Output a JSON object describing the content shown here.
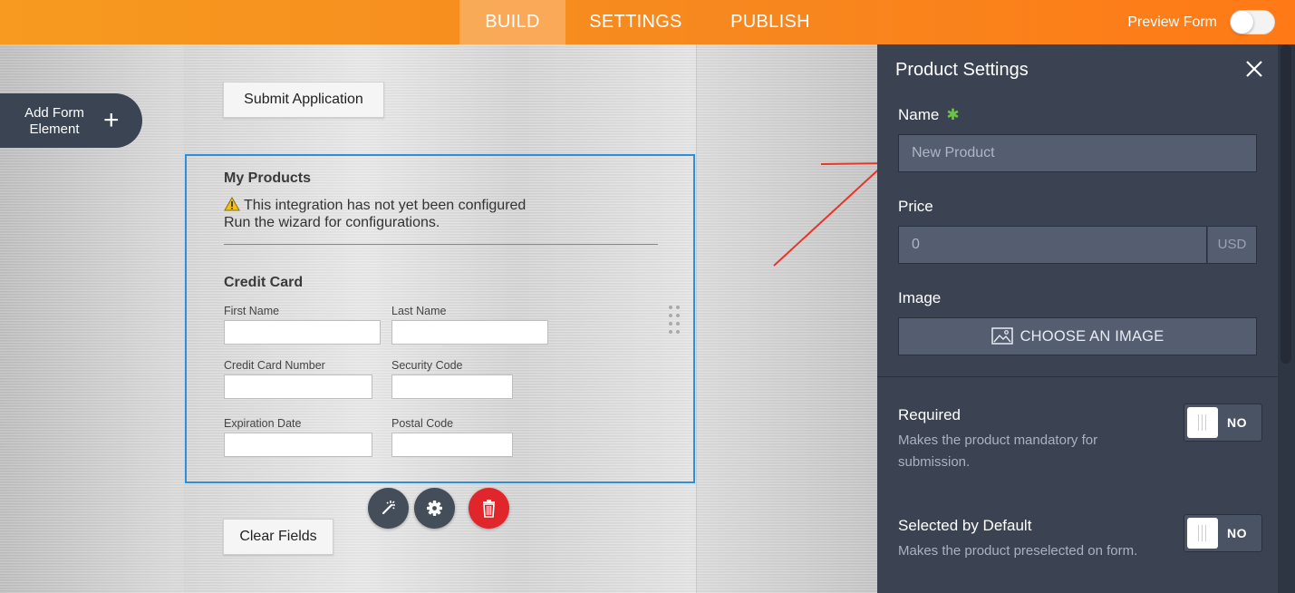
{
  "topbar": {
    "tabs": [
      "BUILD",
      "SETTINGS",
      "PUBLISH"
    ],
    "active_tab": "BUILD",
    "preview_label": "Preview Form",
    "preview_enabled": false
  },
  "sidebar": {
    "add_element_label": "Add Form Element",
    "add_icon": "plus-icon"
  },
  "form": {
    "submit_label": "Submit Application",
    "clear_label": "Clear Fields",
    "product_block": {
      "title": "My Products",
      "warning_line1": "This integration has not yet been configured",
      "warning_line2": "Run the wizard for configurations.",
      "warning_icon": "warning-icon",
      "section_title": "Credit Card",
      "fields": {
        "first_name": "First Name",
        "last_name": "Last Name",
        "card_number": "Credit Card Number",
        "security_code": "Security Code",
        "expiration": "Expiration Date",
        "postal_code": "Postal Code"
      }
    },
    "actions": [
      "wand-icon",
      "gear-icon",
      "trash-icon"
    ]
  },
  "panel": {
    "title": "Product Settings",
    "name_label": "Name",
    "name_required_mark": "✱",
    "name_placeholder": "New Product",
    "price_label": "Price",
    "price_value": "0",
    "currency": "USD",
    "image_label": "Image",
    "choose_image_label": "CHOOSE AN IMAGE",
    "required": {
      "label": "Required",
      "desc": "Makes the product mandatory for submission.",
      "toggle": "NO"
    },
    "selected_default": {
      "label": "Selected by Default",
      "desc": "Makes the product preselected on form.",
      "toggle": "NO"
    }
  },
  "colors": {
    "topbar": "#f7881f",
    "panel_bg": "#3b4352",
    "selection_border": "#2d8fd9",
    "delete": "#e0262a",
    "required_star": "#6dc34a",
    "annotation_arrow": "#e8352a"
  }
}
